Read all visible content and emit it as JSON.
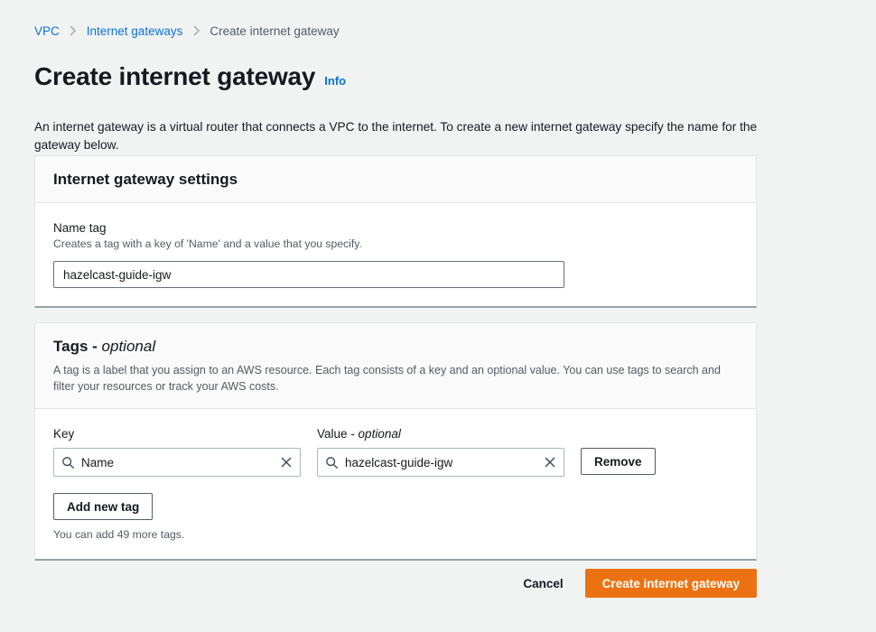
{
  "breadcrumb": {
    "items": [
      {
        "label": "VPC",
        "type": "link"
      },
      {
        "label": "Internet gateways",
        "type": "link"
      },
      {
        "label": "Create internet gateway",
        "type": "current"
      }
    ]
  },
  "header": {
    "title": "Create internet gateway",
    "info_label": "Info",
    "description": "An internet gateway is a virtual router that connects a VPC to the internet. To create a new internet gateway specify the name for the gateway below."
  },
  "settings_panel": {
    "title": "Internet gateway settings",
    "name_tag": {
      "label": "Name tag",
      "hint": "Creates a tag with a key of 'Name' and a value that you specify.",
      "value": "hazelcast-guide-igw",
      "placeholder": ""
    }
  },
  "tags_panel": {
    "title_main": "Tags -",
    "title_optional": "optional",
    "description": "A tag is a label that you assign to an AWS resource. Each tag consists of a key and an optional value. You can use tags to search and filter your resources or track your AWS costs.",
    "key_label": "Key",
    "value_label_main": "Value -",
    "value_label_optional": "optional",
    "rows": [
      {
        "key": "Name",
        "value": "hazelcast-guide-igw",
        "remove_label": "Remove"
      }
    ],
    "add_tag_label": "Add new tag",
    "note": "You can add 49 more tags."
  },
  "footer": {
    "cancel_label": "Cancel",
    "submit_label": "Create internet gateway"
  },
  "colors": {
    "accent_blue": "#0972d3",
    "primary_orange": "#ec7211",
    "page_background": "#f1f3f3",
    "panel_background": "#ffffff",
    "panel_header_background": "#fafafa"
  }
}
